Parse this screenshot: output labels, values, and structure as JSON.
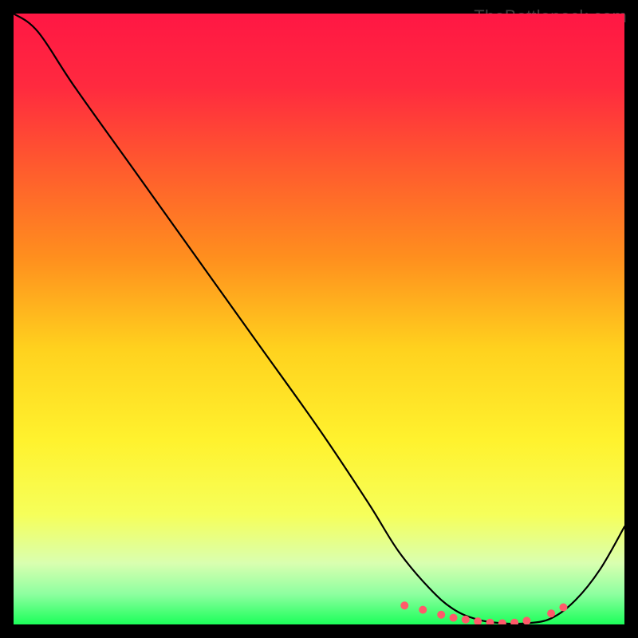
{
  "watermark": "TheBottleneck.com",
  "chart_data": {
    "type": "line",
    "title": "",
    "xlabel": "",
    "ylabel": "",
    "xlim": [
      0,
      100
    ],
    "ylim": [
      0,
      100
    ],
    "grid": false,
    "legend": false,
    "gradient_stops": [
      {
        "pos": 0.0,
        "color": "#ff1744"
      },
      {
        "pos": 0.12,
        "color": "#ff2a3f"
      },
      {
        "pos": 0.25,
        "color": "#ff5a2e"
      },
      {
        "pos": 0.4,
        "color": "#ff8f1e"
      },
      {
        "pos": 0.55,
        "color": "#ffd21e"
      },
      {
        "pos": 0.7,
        "color": "#fff22e"
      },
      {
        "pos": 0.82,
        "color": "#f6ff5a"
      },
      {
        "pos": 0.9,
        "color": "#d9ffb0"
      },
      {
        "pos": 0.95,
        "color": "#8effa0"
      },
      {
        "pos": 1.0,
        "color": "#1cff5a"
      }
    ],
    "series": [
      {
        "name": "curve",
        "color": "#000000",
        "x": [
          0,
          4,
          10,
          20,
          30,
          40,
          50,
          58,
          63,
          68,
          72,
          76,
          80,
          84,
          88,
          92,
          96,
          100
        ],
        "y": [
          100,
          97,
          88,
          74,
          60,
          46,
          32,
          20,
          12,
          6,
          2.5,
          0.8,
          0.2,
          0.2,
          1.0,
          4,
          9,
          16
        ]
      }
    ],
    "markers": {
      "name": "trough-markers",
      "color": "#ff5a6a",
      "radius": 5,
      "points": [
        {
          "x": 64,
          "y": 3.1
        },
        {
          "x": 67,
          "y": 2.4
        },
        {
          "x": 70,
          "y": 1.6
        },
        {
          "x": 72,
          "y": 1.1
        },
        {
          "x": 74,
          "y": 0.8
        },
        {
          "x": 76,
          "y": 0.5
        },
        {
          "x": 78,
          "y": 0.3
        },
        {
          "x": 80,
          "y": 0.2
        },
        {
          "x": 82,
          "y": 0.3
        },
        {
          "x": 84,
          "y": 0.6
        },
        {
          "x": 88,
          "y": 1.8
        },
        {
          "x": 90,
          "y": 2.8
        }
      ]
    }
  }
}
